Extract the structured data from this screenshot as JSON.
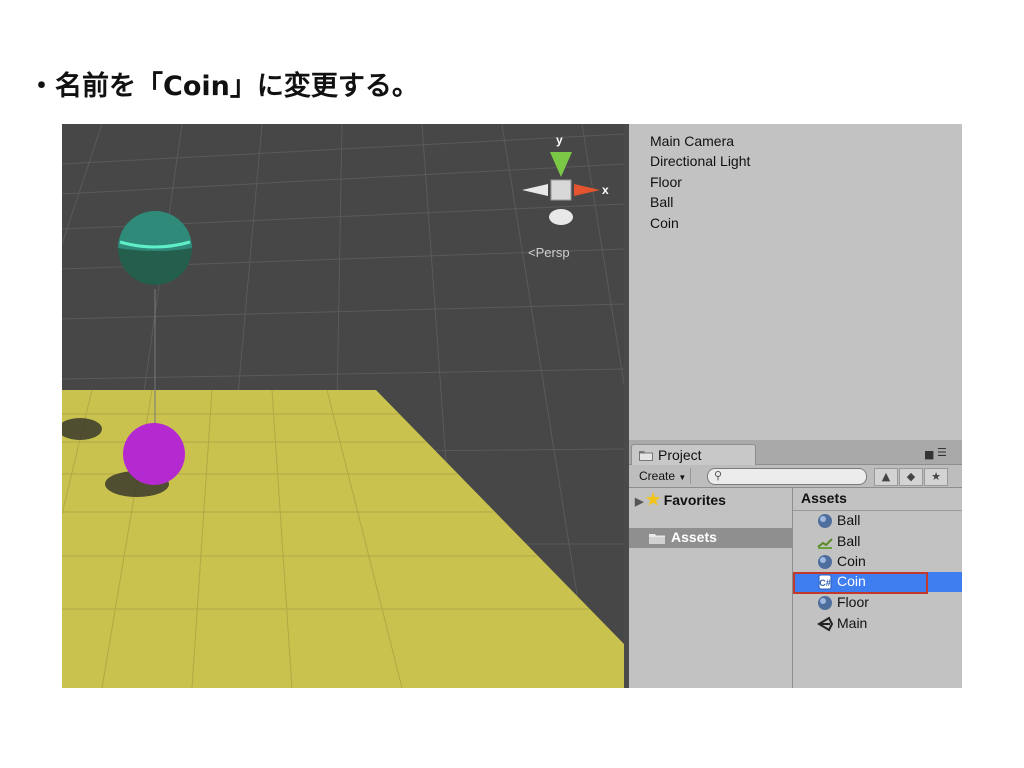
{
  "instruction": "・名前を「Coin」に変更する。",
  "scene": {
    "persp_label": "Persp",
    "gizmo_y_label": "y",
    "gizmo_x_label": "x"
  },
  "hierarchy": {
    "items": [
      "Main Camera",
      "Directional Light",
      "Floor",
      "Ball",
      "Coin"
    ]
  },
  "project": {
    "tab_label": "Project",
    "create_label": "Create",
    "favorites_label": "Favorites",
    "assets_folder_label": "Assets",
    "assets_header": "Assets",
    "assets": [
      {
        "label": "Ball",
        "icon": "sphere-icon"
      },
      {
        "label": "Ball",
        "icon": "physic-material-icon"
      },
      {
        "label": "Coin",
        "icon": "sphere-icon"
      },
      {
        "label": "Coin",
        "icon": "script-icon",
        "selected": true
      },
      {
        "label": "Floor",
        "icon": "sphere-icon"
      },
      {
        "label": "Main",
        "icon": "unity-scene-icon"
      }
    ]
  },
  "colors": {
    "selection": "#3f7ef0",
    "highlight_border": "#c0392b",
    "floor": "#c9c24f",
    "ball": "#b52ad0",
    "coin_sphere": "#2c8c73"
  }
}
